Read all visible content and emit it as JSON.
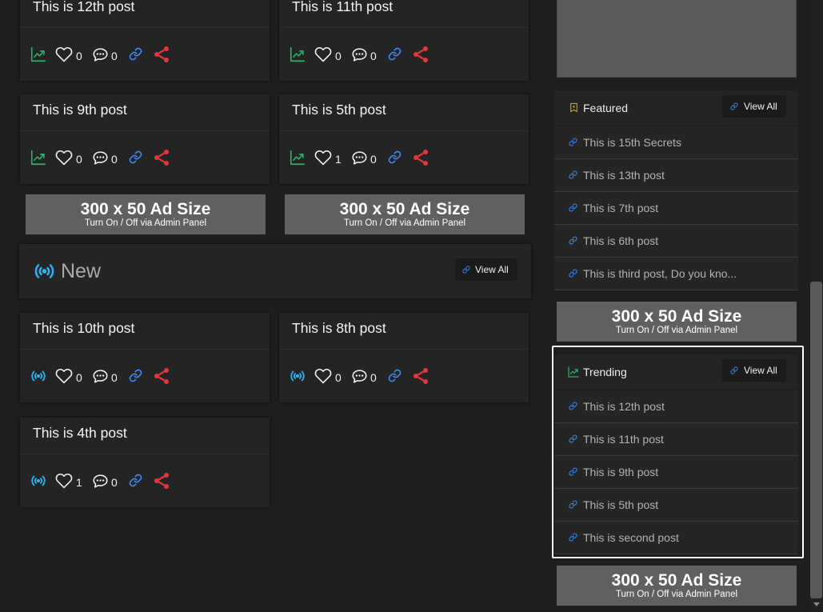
{
  "colors": {
    "page_background": "#1e1e1e",
    "card_background": "#242424",
    "trend_icon": "#2fae68",
    "broadcast_icon": "#2ab4ef",
    "link_icon": "#3e8cf5",
    "share_icon": "#e2373d",
    "featured_icon": "#f0b000",
    "highlight_border": "#ffffff"
  },
  "ad": {
    "headline": "300 x 50 Ad Size",
    "note": "Turn On / Off via Admin Panel"
  },
  "trending_grid": {
    "icon": "trend-icon",
    "posts": [
      {
        "title": "This is 12th post",
        "likes": 0,
        "comments": 0
      },
      {
        "title": "This is 11th post",
        "likes": 0,
        "comments": 0
      },
      {
        "title": "This is 9th post",
        "likes": 0,
        "comments": 0
      },
      {
        "title": "This is 5th post",
        "likes": 1,
        "comments": 0
      }
    ]
  },
  "new_section": {
    "icon": "broadcast-icon",
    "title": "New",
    "view_all": "View All",
    "posts": [
      {
        "title": "This is 10th post",
        "likes": 0,
        "comments": 0
      },
      {
        "title": "This is 8th post",
        "likes": 0,
        "comments": 0
      },
      {
        "title": "This is 4th post",
        "likes": 1,
        "comments": 0
      }
    ]
  },
  "sidebar": {
    "featured": {
      "icon": "bookmark-star-icon",
      "title": "Featured",
      "view_all": "View All",
      "items": [
        "This is 15th Secrets",
        "This is 13th post",
        "This is 7th post",
        "This is 6th post",
        "This is third post, Do you kno..."
      ]
    },
    "trending": {
      "icon": "trend-icon",
      "title": "Trending",
      "view_all": "View All",
      "items": [
        "This is 12th post",
        "This is 11th post",
        "This is 9th post",
        "This is 5th post",
        "This is second post"
      ]
    }
  }
}
